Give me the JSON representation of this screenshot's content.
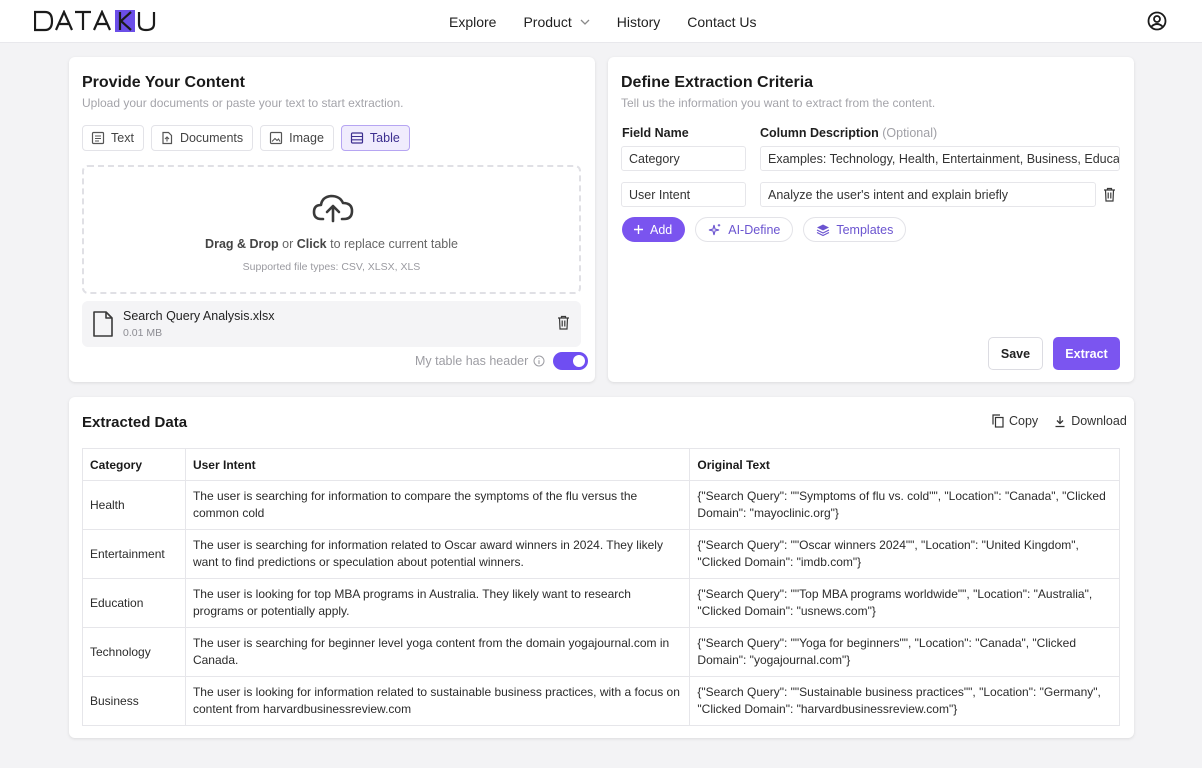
{
  "brand": {
    "letters": [
      "D",
      "A",
      "T",
      "A",
      "K",
      "U"
    ],
    "accent_color": "#6b4ee8"
  },
  "nav": {
    "items": [
      {
        "label": "Explore"
      },
      {
        "label": "Product"
      },
      {
        "label": "History"
      },
      {
        "label": "Contact Us"
      }
    ]
  },
  "content_panel": {
    "title": "Provide Your Content",
    "subtitle": "Upload your documents or paste your text to start extraction.",
    "tabs": [
      {
        "label": "Text",
        "icon": "text-icon"
      },
      {
        "label": "Documents",
        "icon": "document-upload-icon"
      },
      {
        "label": "Image",
        "icon": "image-icon"
      },
      {
        "label": "Table",
        "icon": "table-icon",
        "active": true
      }
    ],
    "dropzone": {
      "strong1": "Drag & Drop",
      "mid": " or ",
      "strong2": "Click",
      "rest": " to replace current table",
      "hint": "Supported file types: CSV, XLSX, XLS"
    },
    "file": {
      "name": "Search Query Analysis.xlsx",
      "size": "0.01 MB"
    },
    "header_toggle": {
      "label": "My table has header",
      "on": true
    }
  },
  "criteria_panel": {
    "title": "Define Extraction Criteria",
    "subtitle": "Tell us the information you want to extract from the content.",
    "field_name_header": "Field Name",
    "description_header": "Column Description",
    "description_optional": "(Optional)",
    "rows": [
      {
        "field": "Category",
        "description": "Examples: Technology, Health, Entertainment, Business, Education"
      },
      {
        "field": "User Intent",
        "description": "Analyze the user's intent and explain briefly"
      }
    ],
    "add_label": "Add",
    "ai_define_label": "AI-Define",
    "templates_label": "Templates",
    "save_label": "Save",
    "extract_label": "Extract"
  },
  "extracted": {
    "title": "Extracted Data",
    "copy_label": "Copy",
    "download_label": "Download",
    "columns": [
      "Category",
      "User Intent",
      "Original Text"
    ],
    "rows": [
      [
        "Health",
        "The user is searching for information to compare the symptoms of the flu versus the common cold",
        "{\"Search Query\": \"\"Symptoms of flu vs. cold\"\", \"Location\": \"Canada\", \"Clicked Domain\": \"mayoclinic.org\"}"
      ],
      [
        "Entertainment",
        "The user is searching for information related to Oscar award winners in 2024. They likely want to find predictions or speculation about potential winners.",
        "{\"Search Query\": \"\"Oscar winners 2024\"\", \"Location\": \"United Kingdom\", \"Clicked Domain\": \"imdb.com\"}"
      ],
      [
        "Education",
        "The user is looking for top MBA programs in Australia. They likely want to research programs or potentially apply.",
        "{\"Search Query\": \"\"Top MBA programs worldwide\"\", \"Location\": \"Australia\", \"Clicked Domain\": \"usnews.com\"}"
      ],
      [
        "Technology",
        "The user is searching for beginner level yoga content from the domain yogajournal.com in Canada.",
        "{\"Search Query\": \"\"Yoga for beginners\"\", \"Location\": \"Canada\", \"Clicked Domain\": \"yogajournal.com\"}"
      ],
      [
        "Business",
        "The user is looking for information related to sustainable business practices, with a focus on content from harvardbusinessreview.com",
        "{\"Search Query\": \"\"Sustainable business practices\"\", \"Location\": \"Germany\", \"Clicked Domain\": \"harvardbusinessreview.com\"}"
      ]
    ]
  }
}
